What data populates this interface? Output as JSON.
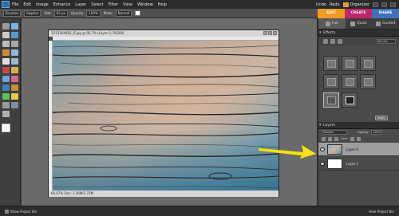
{
  "menubar": {
    "items": [
      "File",
      "Edit",
      "Image",
      "Enhance",
      "Layer",
      "Select",
      "Filter",
      "View",
      "Window",
      "Help"
    ],
    "right": [
      "Undo",
      "Redo",
      "Organizer"
    ]
  },
  "options": {
    "mode": "Brushes",
    "mode2": "Regular",
    "size_label": "Size",
    "size_value": "65 px",
    "opacity_label": "Opacity",
    "opacity_value": "100%",
    "mode_label": "Mode",
    "mode_value": "Normal"
  },
  "modetabs": {
    "edit": "EDIT",
    "create": "CREATE",
    "share": "SHARE"
  },
  "document": {
    "title": "1213364683_IF.jpg @ 66.7% (Layer 0, RGB/8)",
    "status": "66.67%   Doc: 1.36M/2.72M"
  },
  "panel": {
    "subtabs": [
      "Full",
      "Quick",
      "Guided"
    ],
    "effects_title": "Effects",
    "effects_dropdown": "Bevels",
    "apply_label": "Apply",
    "layers_title": "Layers",
    "blend_mode": "Normal",
    "opacity_label": "Opacity:",
    "opacity_value": "100%",
    "lock_label": "Lock:",
    "layers": [
      {
        "name": "Layer 0"
      },
      {
        "name": "Layer 1"
      }
    ]
  },
  "statusbar": {
    "left": "Show Project Bin",
    "right": "Hide Project Bin"
  },
  "colors": {
    "edit": "#f19a22",
    "create": "#c0246a",
    "share": "#3e72b8",
    "arrow": "#f4e41c"
  }
}
